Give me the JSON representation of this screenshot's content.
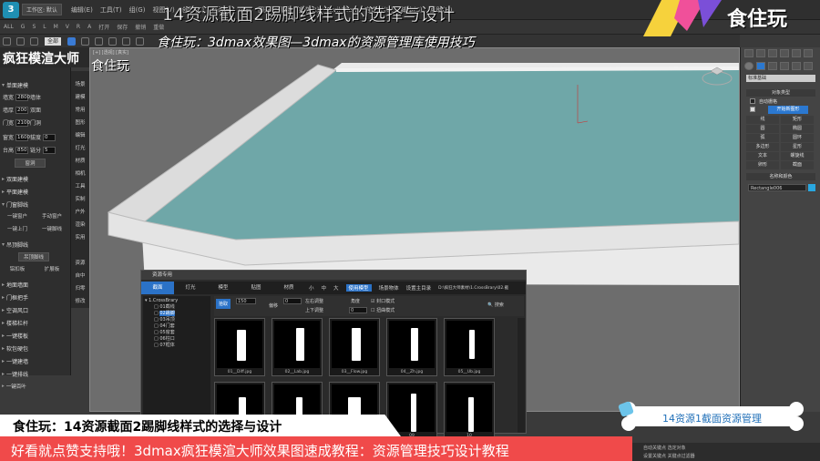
{
  "menubar": {
    "workspace": "工作区: 默认",
    "items": [
      "编辑(E)",
      "工具(T)",
      "组(G)",
      "视图(V)",
      "创建(C)",
      "修改器",
      "动画",
      "图形编辑器",
      "渲染(R)",
      "Civil View",
      "自定义(U)",
      "脚本(S)",
      "帮助(H)"
    ]
  },
  "toolbar1": {
    "items": [
      "ALL",
      "G",
      "S",
      "L",
      "M",
      "V",
      "R",
      "A",
      "打开",
      "保存",
      "撤销",
      "重做"
    ],
    "select_all": "全部"
  },
  "brand": "疯狂模渲大师",
  "watermark": "食住玩",
  "left_panel": {
    "sections_top": "单面建模",
    "rows": [
      {
        "label": "墙宽",
        "value": "2800",
        "label2": "墙体"
      },
      {
        "label": "墙厚",
        "value": "200",
        "label2": "双面"
      },
      {
        "label": "门宽",
        "value": "2100",
        "label2": "门洞"
      },
      {
        "label": "窗宽",
        "value": "1600",
        "label2": "拔度",
        "value2": "0"
      },
      {
        "label": "台高",
        "value": "850",
        "label2": "链分",
        "value2": "5"
      }
    ],
    "button_window": "窗洞",
    "sections": [
      "双面建模",
      "平面建模",
      "门窗脚线"
    ],
    "door_buttons": [
      "一键窗户",
      "手动窗户",
      "一键上门",
      "一键脚线"
    ],
    "ceiling_section": "吊顶脚线",
    "ceiling_button": "吊顶脚线",
    "ceiling_buttons": [
      "铝扣板",
      "扩展板"
    ],
    "sections_bottom": [
      "地面墙面",
      "门框把手",
      "空调风口",
      "楼梯栏杆",
      "一键楼板",
      "软包硬包",
      "一键建墙",
      "一键排线",
      "一键百叶"
    ]
  },
  "side_column": [
    "场景",
    "建模",
    "常用",
    "图形",
    "编辑",
    "灯光",
    "材质",
    "相机",
    "工具",
    "实制",
    "户外",
    "渲染",
    "实用",
    "资源",
    "自中",
    "归零",
    "修改"
  ],
  "viewport": {
    "label": "[+] [透视] [真实]"
  },
  "right_panel": {
    "combo": "标准基础",
    "object_type_title": "对象类型",
    "autogrid": "自动栅格",
    "start_new_shape": "开始新图形",
    "buttons": [
      "线",
      "矩形",
      "圆",
      "椭圆",
      "弧",
      "圆环",
      "多边形",
      "星形",
      "文本",
      "螺旋线",
      "卵形",
      "截面"
    ],
    "name_color_title": "名称和颜色",
    "name_value": "Rectangle006"
  },
  "dialog": {
    "title": "资源专用",
    "tabs": [
      "截面",
      "灯光",
      "模型",
      "贴图",
      "材质"
    ],
    "options": [
      "小",
      "中",
      "大",
      "使用模型",
      "场景物体",
      "设置主目录"
    ],
    "path": "D:\\疯狂大师素材\\1.CrossBrary\\02.截",
    "tree": [
      "1.CrossBrary",
      "01截线",
      "02踢脚",
      "03吊顶",
      "04门套",
      "05窗套",
      "06柱口",
      "07框体"
    ],
    "selected_tree_index": 2,
    "controls": {
      "pick": "拾取",
      "align_label": "左右调整",
      "updown_label": "上下调整",
      "offset_label": "偏移",
      "angle_label": "角度",
      "field_value_1": "150",
      "field_value_2": "0",
      "field_value_3": "0",
      "checkbox1": "封口模式",
      "checkbox2": "扭曲模式",
      "search": "搜索"
    },
    "thumbs": [
      "01__Diff.jpg",
      "02__Lab.jpg",
      "03__Flow.jpg",
      "04__Zh.jpg",
      "05__Ub.jpg",
      "06",
      "07",
      "08",
      "09",
      "10"
    ],
    "thumb_label": "材质"
  },
  "overlay": {
    "title": "14资源截面2踢脚线样式的选择与设计",
    "subtitle": "食住玩：3dmax效果图—3dmax的资源管理库使用技巧",
    "logo_text": "食住玩",
    "bone_text": "14资源1截面资源管理",
    "bottom_title": "食住玩：14资源截面2踢脚线样式的选择与设计",
    "bottom_banner": "好看就点赞支持哦！3dmax疯狂模渲大师效果图速成教程：资源管理技巧设计教程"
  },
  "statusbar": {
    "line1": "自动关键点   选定对象",
    "line2": "设置关键点   关键点过滤器"
  },
  "colors": {
    "floor": "#6fa7a8",
    "wall": "#e4e4e4",
    "accent": "#2b72c7",
    "banner": "#f04a4a"
  }
}
